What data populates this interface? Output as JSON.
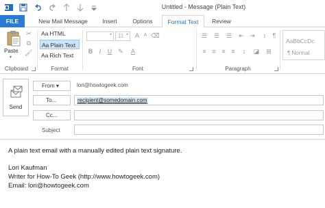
{
  "window": {
    "title": "Untitled - Message (Plain Text)"
  },
  "tabs": [
    "FILE",
    "New Mail Message",
    "Insert",
    "Options",
    "Format Text",
    "Review"
  ],
  "active_tab": "Format Text",
  "ribbon": {
    "clipboard": {
      "paste_label": "Paste",
      "group_label": "Clipboard"
    },
    "format": {
      "group_label": "Format",
      "items": [
        {
          "aa": "Aa",
          "label": "HTML"
        },
        {
          "aa": "Aa",
          "label": "Plain Text"
        },
        {
          "aa": "Aa",
          "label": "Rich Text"
        }
      ],
      "selected": "Plain Text"
    },
    "font": {
      "group_label": "Font",
      "size": "11"
    },
    "paragraph": {
      "group_label": "Paragraph"
    },
    "styles": {
      "sample": "AaBbCcDc",
      "normal_label": "¶ Normal"
    }
  },
  "send": {
    "label": "Send"
  },
  "header": {
    "from_button": "From ▾",
    "from_address": "lori@howtogeek.com",
    "to_button": "To...",
    "to_value": "recipient@somedomain.com",
    "cc_button": "Cc...",
    "cc_value": "",
    "subject_label": "Subject",
    "subject_value": ""
  },
  "body": {
    "lines": [
      "A plain text email with a manually edited plain text signature.",
      "",
      "Lori Kaufman",
      "Writer for How-To Geek (http://www.howtogeek.com)",
      "Email: lori@howtogeek.com"
    ]
  },
  "colors": {
    "file_tab": "#2b7bd3",
    "active_tab_text": "#2b6fc1",
    "selected_format": "#cde6f7"
  }
}
